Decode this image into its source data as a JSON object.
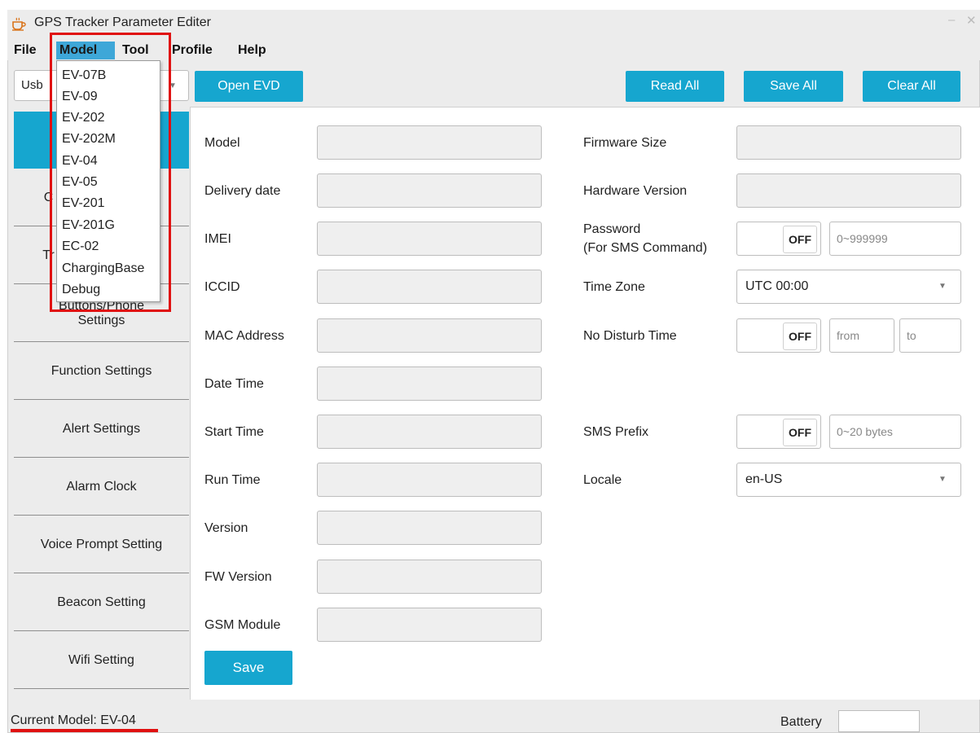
{
  "window": {
    "title": "GPS Tracker Parameter Editer",
    "app_icon": "cup-icon",
    "minimize_icon": "minimize-icon",
    "close_icon": "close-icon"
  },
  "menubar": {
    "file": "File",
    "model": "Model",
    "tool": "Tool",
    "profile": "Profile",
    "help": "Help"
  },
  "model_menu": {
    "items": [
      "EV-07B",
      "EV-09",
      "EV-202",
      "EV-202M",
      "EV-04",
      "EV-05",
      "EV-201",
      "EV-201G",
      "EC-02",
      "ChargingBase",
      "Debug"
    ]
  },
  "toolbar": {
    "port_value": "Usb",
    "open_evd": "Open EVD",
    "read_all": "Read All",
    "save_all": "Save All",
    "clear_all": "Clear All"
  },
  "sidebar": {
    "items": [
      {
        "label": ""
      },
      {
        "label": "C"
      },
      {
        "label": "Tr"
      },
      {
        "label": "Buttons/Phone Settings"
      },
      {
        "label": "Function Settings"
      },
      {
        "label": "Alert Settings"
      },
      {
        "label": "Alarm Clock"
      },
      {
        "label": "Voice Prompt Setting"
      },
      {
        "label": "Beacon Setting"
      },
      {
        "label": "Wifi Setting"
      }
    ]
  },
  "left_fields": [
    {
      "label": "Model",
      "value": ""
    },
    {
      "label": "Delivery date",
      "value": ""
    },
    {
      "label": "IMEI",
      "value": ""
    },
    {
      "label": "ICCID",
      "value": ""
    },
    {
      "label": "MAC Address",
      "value": ""
    },
    {
      "label": "Date Time",
      "value": ""
    },
    {
      "label": "Start Time",
      "value": ""
    },
    {
      "label": "Run Time",
      "value": ""
    },
    {
      "label": "Version",
      "value": ""
    },
    {
      "label": "FW Version",
      "value": ""
    },
    {
      "label": "GSM Module",
      "value": ""
    }
  ],
  "right_fields": {
    "firmware_size": {
      "label": "Firmware Size",
      "value": ""
    },
    "hardware_version": {
      "label": "Hardware Version",
      "value": ""
    },
    "password": {
      "label_line1": "Password",
      "label_line2": "(For SMS Command)",
      "toggle": "OFF",
      "placeholder": "0~999999"
    },
    "time_zone": {
      "label": "Time Zone",
      "value": "UTC 00:00"
    },
    "no_disturb": {
      "label": "No Disturb Time",
      "toggle": "OFF",
      "from_placeholder": "from",
      "to_placeholder": "to"
    },
    "sms_prefix": {
      "label": "SMS Prefix",
      "toggle": "OFF",
      "placeholder": "0~20 bytes"
    },
    "locale": {
      "label": "Locale",
      "value": "en-US"
    }
  },
  "save_button": "Save",
  "status": {
    "current_model": "Current Model: EV-04",
    "battery_label": "Battery",
    "battery_value": ""
  },
  "colors": {
    "accent": "#16a6cf",
    "menu_highlight": "#3ea7d8",
    "annotation": "#e01010"
  }
}
